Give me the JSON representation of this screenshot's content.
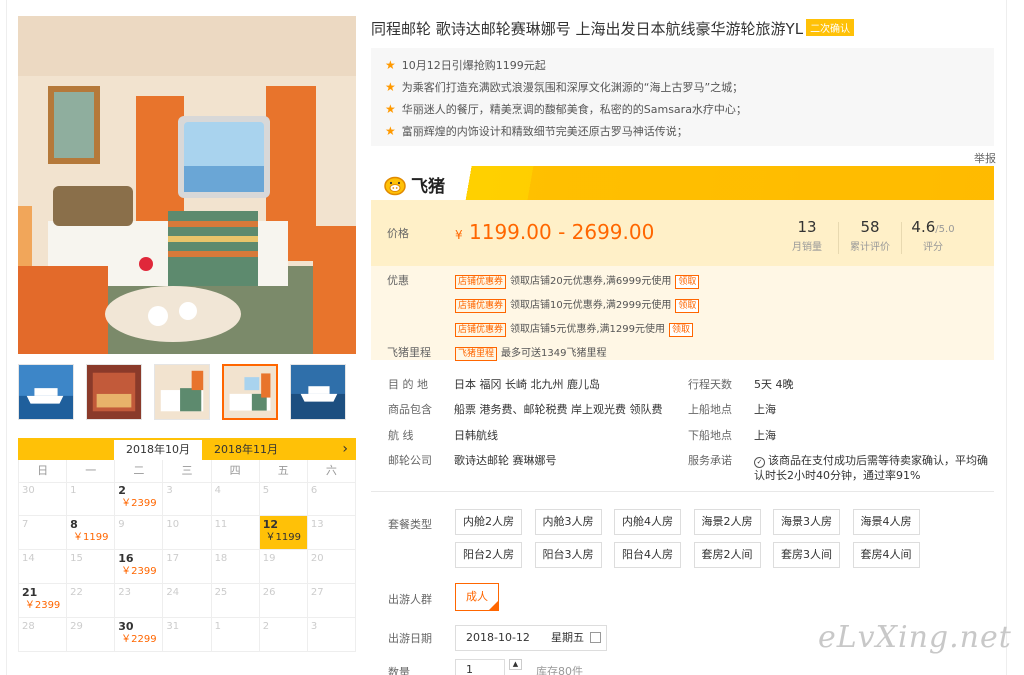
{
  "product": {
    "title": "同程邮轮 歌诗达邮轮赛琳娜号 上海出发日本航线豪华游轮旅游YL",
    "confirm_badge": "二次确认",
    "features": [
      "10月12日引爆抢购1199元起",
      "为乘客们打造充满欧式浪漫氛围和深厚文化渊源的“海上古罗马”之城；",
      "华丽迷人的餐厅，精美烹调的馥郁美食，私密的的Samsara水疗中心；",
      "富丽辉煌的内饰设计和精致细节完美还原古罗马神话传说；"
    ],
    "report": "举报"
  },
  "brand": {
    "name": "飞猪",
    "icon": "pig-logo-icon",
    "color": "#ffc107"
  },
  "pricing": {
    "price_label": "价格",
    "currency": "¥",
    "price_range": "1199.00 - 2699.00",
    "monthly_sales": "13",
    "monthly_sales_label": "月销量",
    "reviews": "58",
    "reviews_label": "累计评价",
    "rating": "4.6",
    "rating_max": "/5.0",
    "rating_label": "评分",
    "discount_label": "优惠",
    "coupons": [
      {
        "tag": "店铺优惠券",
        "text": "领取店铺20元优惠券,满6999元使用",
        "action": "领取"
      },
      {
        "tag": "店铺优惠券",
        "text": "领取店铺10元优惠券,满2999元使用",
        "action": "领取"
      },
      {
        "tag": "店铺优惠券",
        "text": "领取店铺5元优惠券,满1299元使用",
        "action": "领取"
      }
    ],
    "mileage_label": "飞猪里程",
    "mileage_tag": "飞猪里程",
    "mileage_text": "最多可送1349飞猪里程"
  },
  "info": {
    "destination_label": "目 的 地",
    "destination": "日本  福冈  长崎  北九州  鹿儿岛",
    "days_label": "行程天数",
    "days": "5天  4晚",
    "includes_label": "商品包含",
    "includes": "船票  港务费、邮轮税费  岸上观光费  领队费",
    "board_label": "上船地点",
    "board": "上海",
    "route_label": "航     线",
    "route": "日韩航线",
    "alight_label": "下船地点",
    "alight": "上海",
    "company_label": "邮轮公司",
    "company": "歌诗达邮轮  赛琳娜号",
    "service_label": "服务承诺",
    "service_line1": "该商品在支付成功后需等待卖家确认，平均确",
    "service_line2": "认时长2小时40分钟，通过率91%"
  },
  "options": {
    "package_label": "套餐类型",
    "packages": [
      "内舱2人房",
      "内舱3人房",
      "内舱4人房",
      "海景2人房",
      "海景3人房",
      "海景4人房",
      "阳台2人房",
      "阳台3人房",
      "阳台4人房",
      "套房2人间",
      "套房3人间",
      "套房4人间"
    ],
    "group_label": "出游人群",
    "group": "成人",
    "date_label": "出游日期",
    "date": "2018-10-12",
    "weekday": "星期五",
    "qty_label": "数量",
    "qty": "1",
    "stock": "库存80件"
  },
  "calendar": {
    "tabs": [
      "2018年10月",
      "2018年11月"
    ],
    "next": "›",
    "weekdays": [
      "日",
      "一",
      "二",
      "三",
      "四",
      "五",
      "六"
    ],
    "cells": [
      {
        "d": "30",
        "p": ""
      },
      {
        "d": "1",
        "p": ""
      },
      {
        "d": "2",
        "p": "￥2399",
        "a": true
      },
      {
        "d": "3",
        "p": ""
      },
      {
        "d": "4",
        "p": ""
      },
      {
        "d": "5",
        "p": ""
      },
      {
        "d": "6",
        "p": ""
      },
      {
        "d": "7",
        "p": ""
      },
      {
        "d": "8",
        "p": "￥1199",
        "a": true
      },
      {
        "d": "9",
        "p": ""
      },
      {
        "d": "10",
        "p": ""
      },
      {
        "d": "11",
        "p": ""
      },
      {
        "d": "12",
        "p": "￥1199",
        "a": true,
        "s": true
      },
      {
        "d": "13",
        "p": ""
      },
      {
        "d": "14",
        "p": ""
      },
      {
        "d": "15",
        "p": ""
      },
      {
        "d": "16",
        "p": "￥2399",
        "a": true
      },
      {
        "d": "17",
        "p": ""
      },
      {
        "d": "18",
        "p": ""
      },
      {
        "d": "19",
        "p": ""
      },
      {
        "d": "20",
        "p": ""
      },
      {
        "d": "21",
        "p": "￥2399",
        "a": true
      },
      {
        "d": "22",
        "p": ""
      },
      {
        "d": "23",
        "p": ""
      },
      {
        "d": "24",
        "p": ""
      },
      {
        "d": "25",
        "p": ""
      },
      {
        "d": "26",
        "p": ""
      },
      {
        "d": "27",
        "p": ""
      },
      {
        "d": "28",
        "p": ""
      },
      {
        "d": "29",
        "p": ""
      },
      {
        "d": "30",
        "p": "￥2299",
        "a": true
      },
      {
        "d": "31",
        "p": ""
      },
      {
        "d": "1",
        "p": ""
      },
      {
        "d": "2",
        "p": ""
      },
      {
        "d": "3",
        "p": ""
      }
    ]
  },
  "watermark": "eLvXing.net"
}
